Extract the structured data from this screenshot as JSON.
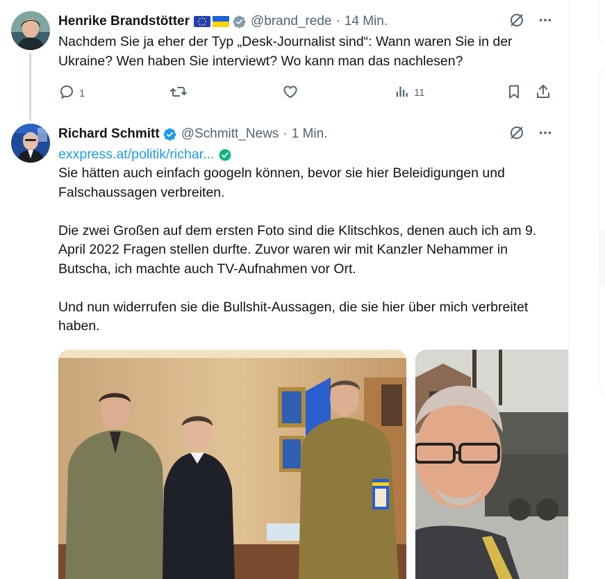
{
  "tweets": [
    {
      "author_name": "Henrike Brandstötter",
      "flags": [
        "eu-flag",
        "ukraine-flag"
      ],
      "badge": "gray-verified-badge",
      "handle": "@brand_rede",
      "separator": "·",
      "time": "14 Min.",
      "text": "Nachdem Sie ja eher der Typ „Desk-Journalist sind“: Wann waren Sie in der Ukraine? Wen haben Sie interviewt? Wo kann man das nachlesen?",
      "actions": {
        "reply_count": "1",
        "retweet_count": "",
        "like_count": "",
        "views_count": "11"
      }
    },
    {
      "author_name": "Richard Schmitt",
      "badge": "blue-verified-badge",
      "handle": "@Schmitt_News",
      "separator": "·",
      "time": "1 Min.",
      "link": "exxpress.at/politik/richar...",
      "text": "Sie hätten auch einfach googeln können, bevor sie hier Beleidigungen und Falschaussagen verbreiten.\n\nDie zwei Großen auf dem ersten Foto sind die Klitschkos, denen auch ich am 9. April 2022 Fragen stellen durfte. Zuvor waren wir mit Kanzler Nehammer in Butscha, ich machte auch TV-Aufnahmen vor Ort.\n\nUnd nun widerrufen sie die Bullshit-Aussagen, die sie hier über mich verbreitet haben.",
      "media": [
        "photo-klitschkos-nehammer",
        "photo-selfie-butscha"
      ]
    }
  ],
  "colors": {
    "text": "#0f1419",
    "secondary": "#536471",
    "link": "#1d9bf0",
    "verified": "#1d9bf0",
    "thread_line": "#cfd9de"
  }
}
